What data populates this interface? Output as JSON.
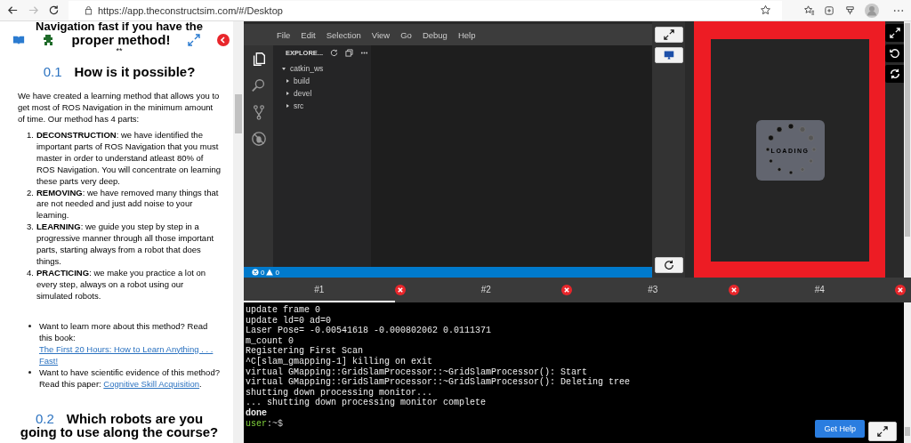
{
  "browser": {
    "url": "https://app.theconstructsim.com/#/Desktop",
    "forward_disabled": true
  },
  "notebook": {
    "title_cut": "Navigation fast if you have the",
    "title": "proper method!",
    "title_mark": "**",
    "section": {
      "number": "0.1",
      "title": "How is it possible?"
    },
    "intro": "We have created a learning method that allows you to get most of ROS Navigation in the minimum amount of time. Our method has 4 parts:",
    "steps": [
      {
        "number": "1.",
        "text": "**DECONSTRUCTION**: we have identified the important parts of ROS Navigation that you must master in order to understand atleast 80% of ROS Navigation. You will concentrate on learning these parts very deep."
      },
      {
        "number": "2.",
        "text": "**REMOVING**: we have removed many things that are not needed and just add noise to your learning."
      },
      {
        "number": "3.",
        "text": "**LEARNING**: we guide you step by step in a progressive manner through all those important parts, starting always from a robot that does things."
      },
      {
        "number": "4.",
        "text": "**PRACTICING**: we make you practice a lot on every step, always on a robot using our simulated robots."
      }
    ],
    "links": [
      {
        "before": "Want to learn more about this method? Read this book: ",
        "link": "The First 20 Hours: How to Learn Anything . . . Fast!"
      },
      {
        "before": "Want to have scientific evidence of this method? Read this paper: ",
        "link": "Cognitive Skill Acquisition",
        "after": "."
      }
    ],
    "next_section": {
      "number": "0.2",
      "title": "Which robots are you",
      "title_cut": "going to use along the course?"
    }
  },
  "ide": {
    "menu": [
      "File",
      "Edit",
      "Selection",
      "View",
      "Go",
      "Debug",
      "Help"
    ],
    "explorer_title": "EXPLORE...",
    "tree": [
      {
        "label": "catkin_ws",
        "expanded": true,
        "children": [
          {
            "label": "build",
            "expanded": false
          },
          {
            "label": "devel",
            "expanded": false
          },
          {
            "label": "src",
            "expanded": false
          }
        ]
      }
    ],
    "errors": "0",
    "warnings": "0"
  },
  "simulation": {
    "loading": "LOADING"
  },
  "terminal_tabs": [
    {
      "label": "#1",
      "selected": true
    },
    {
      "label": "#2",
      "selected": false
    },
    {
      "label": "#3",
      "selected": false
    },
    {
      "label": "#4",
      "selected": false
    }
  ],
  "terminal": {
    "lines": [
      {
        "kind": "output",
        "text": "update frame 0"
      },
      {
        "kind": "output",
        "text": "update ld=0 ad=0"
      },
      {
        "kind": "output",
        "text": "Laser Pose= -0.00541618 -0.000802062 0.0111371"
      },
      {
        "kind": "output",
        "text": "m_count 0"
      },
      {
        "kind": "output",
        "text": "Registering First Scan"
      },
      {
        "kind": "output",
        "text": "^C[slam_gmapping-1] killing on exit"
      },
      {
        "kind": "output",
        "text": "virtual GMapping::GridSlamProcessor::~GridSlamProcessor(): Start"
      },
      {
        "kind": "output",
        "text": "virtual GMapping::GridSlamProcessor::~GridSlamProcessor(): Deleting tree"
      },
      {
        "kind": "output",
        "text": "shutting down processing monitor..."
      },
      {
        "kind": "output",
        "text": "... shutting down processing monitor complete"
      },
      {
        "kind": "bold",
        "text": "done"
      },
      {
        "kind": "prompt",
        "user": "user",
        "path": ":~$"
      }
    ],
    "help_button": "Get Help"
  }
}
